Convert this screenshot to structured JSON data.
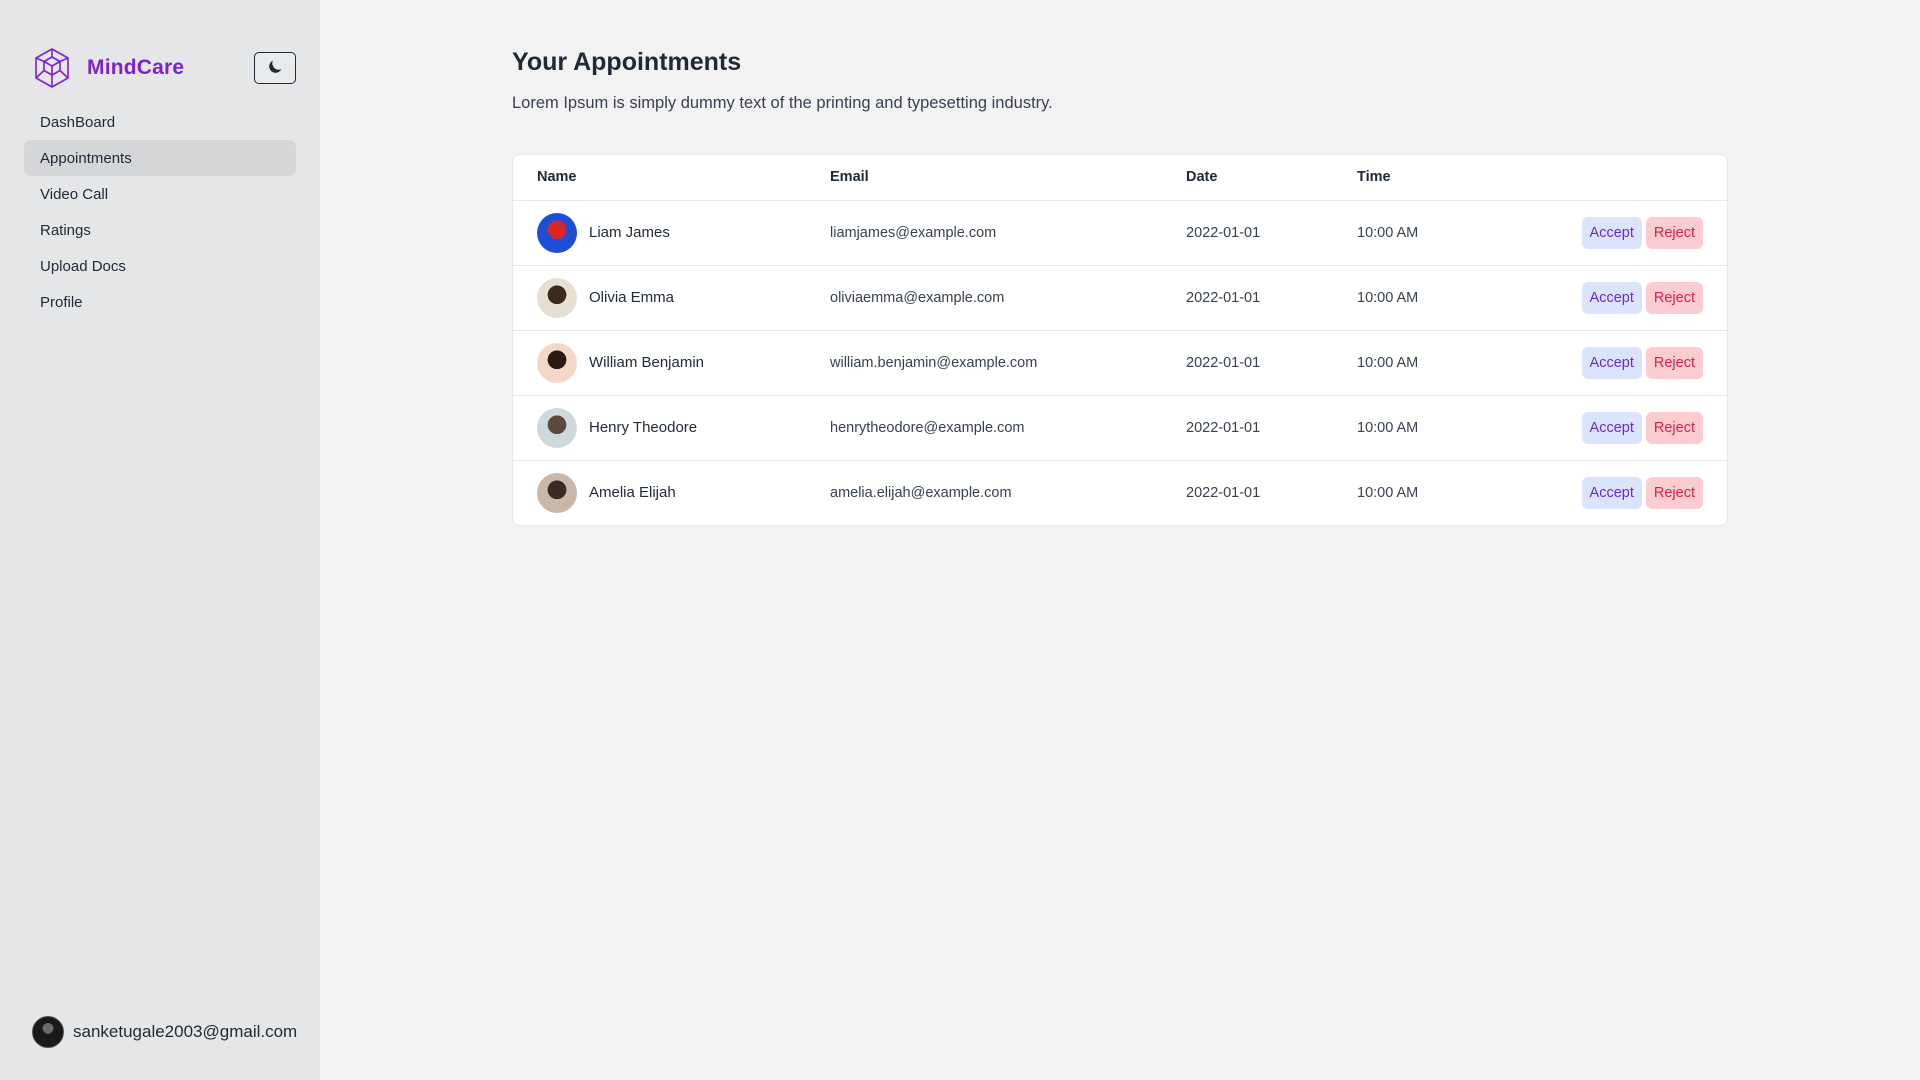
{
  "brand": {
    "name": "MindCare",
    "accent": "#7e22ce"
  },
  "icons": {
    "logo": "hexagon-cube-logo-icon",
    "theme": "moon-icon"
  },
  "sidebar": {
    "items": [
      {
        "label": "DashBoard",
        "active": false
      },
      {
        "label": "Appointments",
        "active": true
      },
      {
        "label": "Video Call",
        "active": false
      },
      {
        "label": "Ratings",
        "active": false
      },
      {
        "label": "Upload Docs",
        "active": false
      },
      {
        "label": "Profile",
        "active": false
      }
    ],
    "user_email": "sanketugale2003@gmail.com"
  },
  "main": {
    "title": "Your Appointments",
    "subtitle": "Lorem Ipsum is simply dummy text of the printing and typesetting industry."
  },
  "table": {
    "headers": {
      "name": "Name",
      "email": "Email",
      "date": "Date",
      "time": "Time"
    },
    "accept_label": "Accept",
    "reject_label": "Reject",
    "rows": [
      {
        "name": "Liam James",
        "email": "liamjames@example.com",
        "date": "2022-01-01",
        "time": "10:00 AM",
        "avatar_colors": [
          "#1d4ed8",
          "#dc2626"
        ]
      },
      {
        "name": "Olivia Emma",
        "email": "oliviaemma@example.com",
        "date": "2022-01-01",
        "time": "10:00 AM",
        "avatar_colors": [
          "#e8dfd3",
          "#3b2a1e"
        ]
      },
      {
        "name": "William Benjamin",
        "email": "william.benjamin@example.com",
        "date": "2022-01-01",
        "time": "10:00 AM",
        "avatar_colors": [
          "#f5d7c6",
          "#2b1a14"
        ]
      },
      {
        "name": "Henry Theodore",
        "email": "henrytheodore@example.com",
        "date": "2022-01-01",
        "time": "10:00 AM",
        "avatar_colors": [
          "#cfd8dc",
          "#5d4a3c"
        ]
      },
      {
        "name": "Amelia Elijah",
        "email": "amelia.elijah@example.com",
        "date": "2022-01-01",
        "time": "10:00 AM",
        "avatar_colors": [
          "#c9b7a9",
          "#3a2a24"
        ]
      }
    ]
  }
}
